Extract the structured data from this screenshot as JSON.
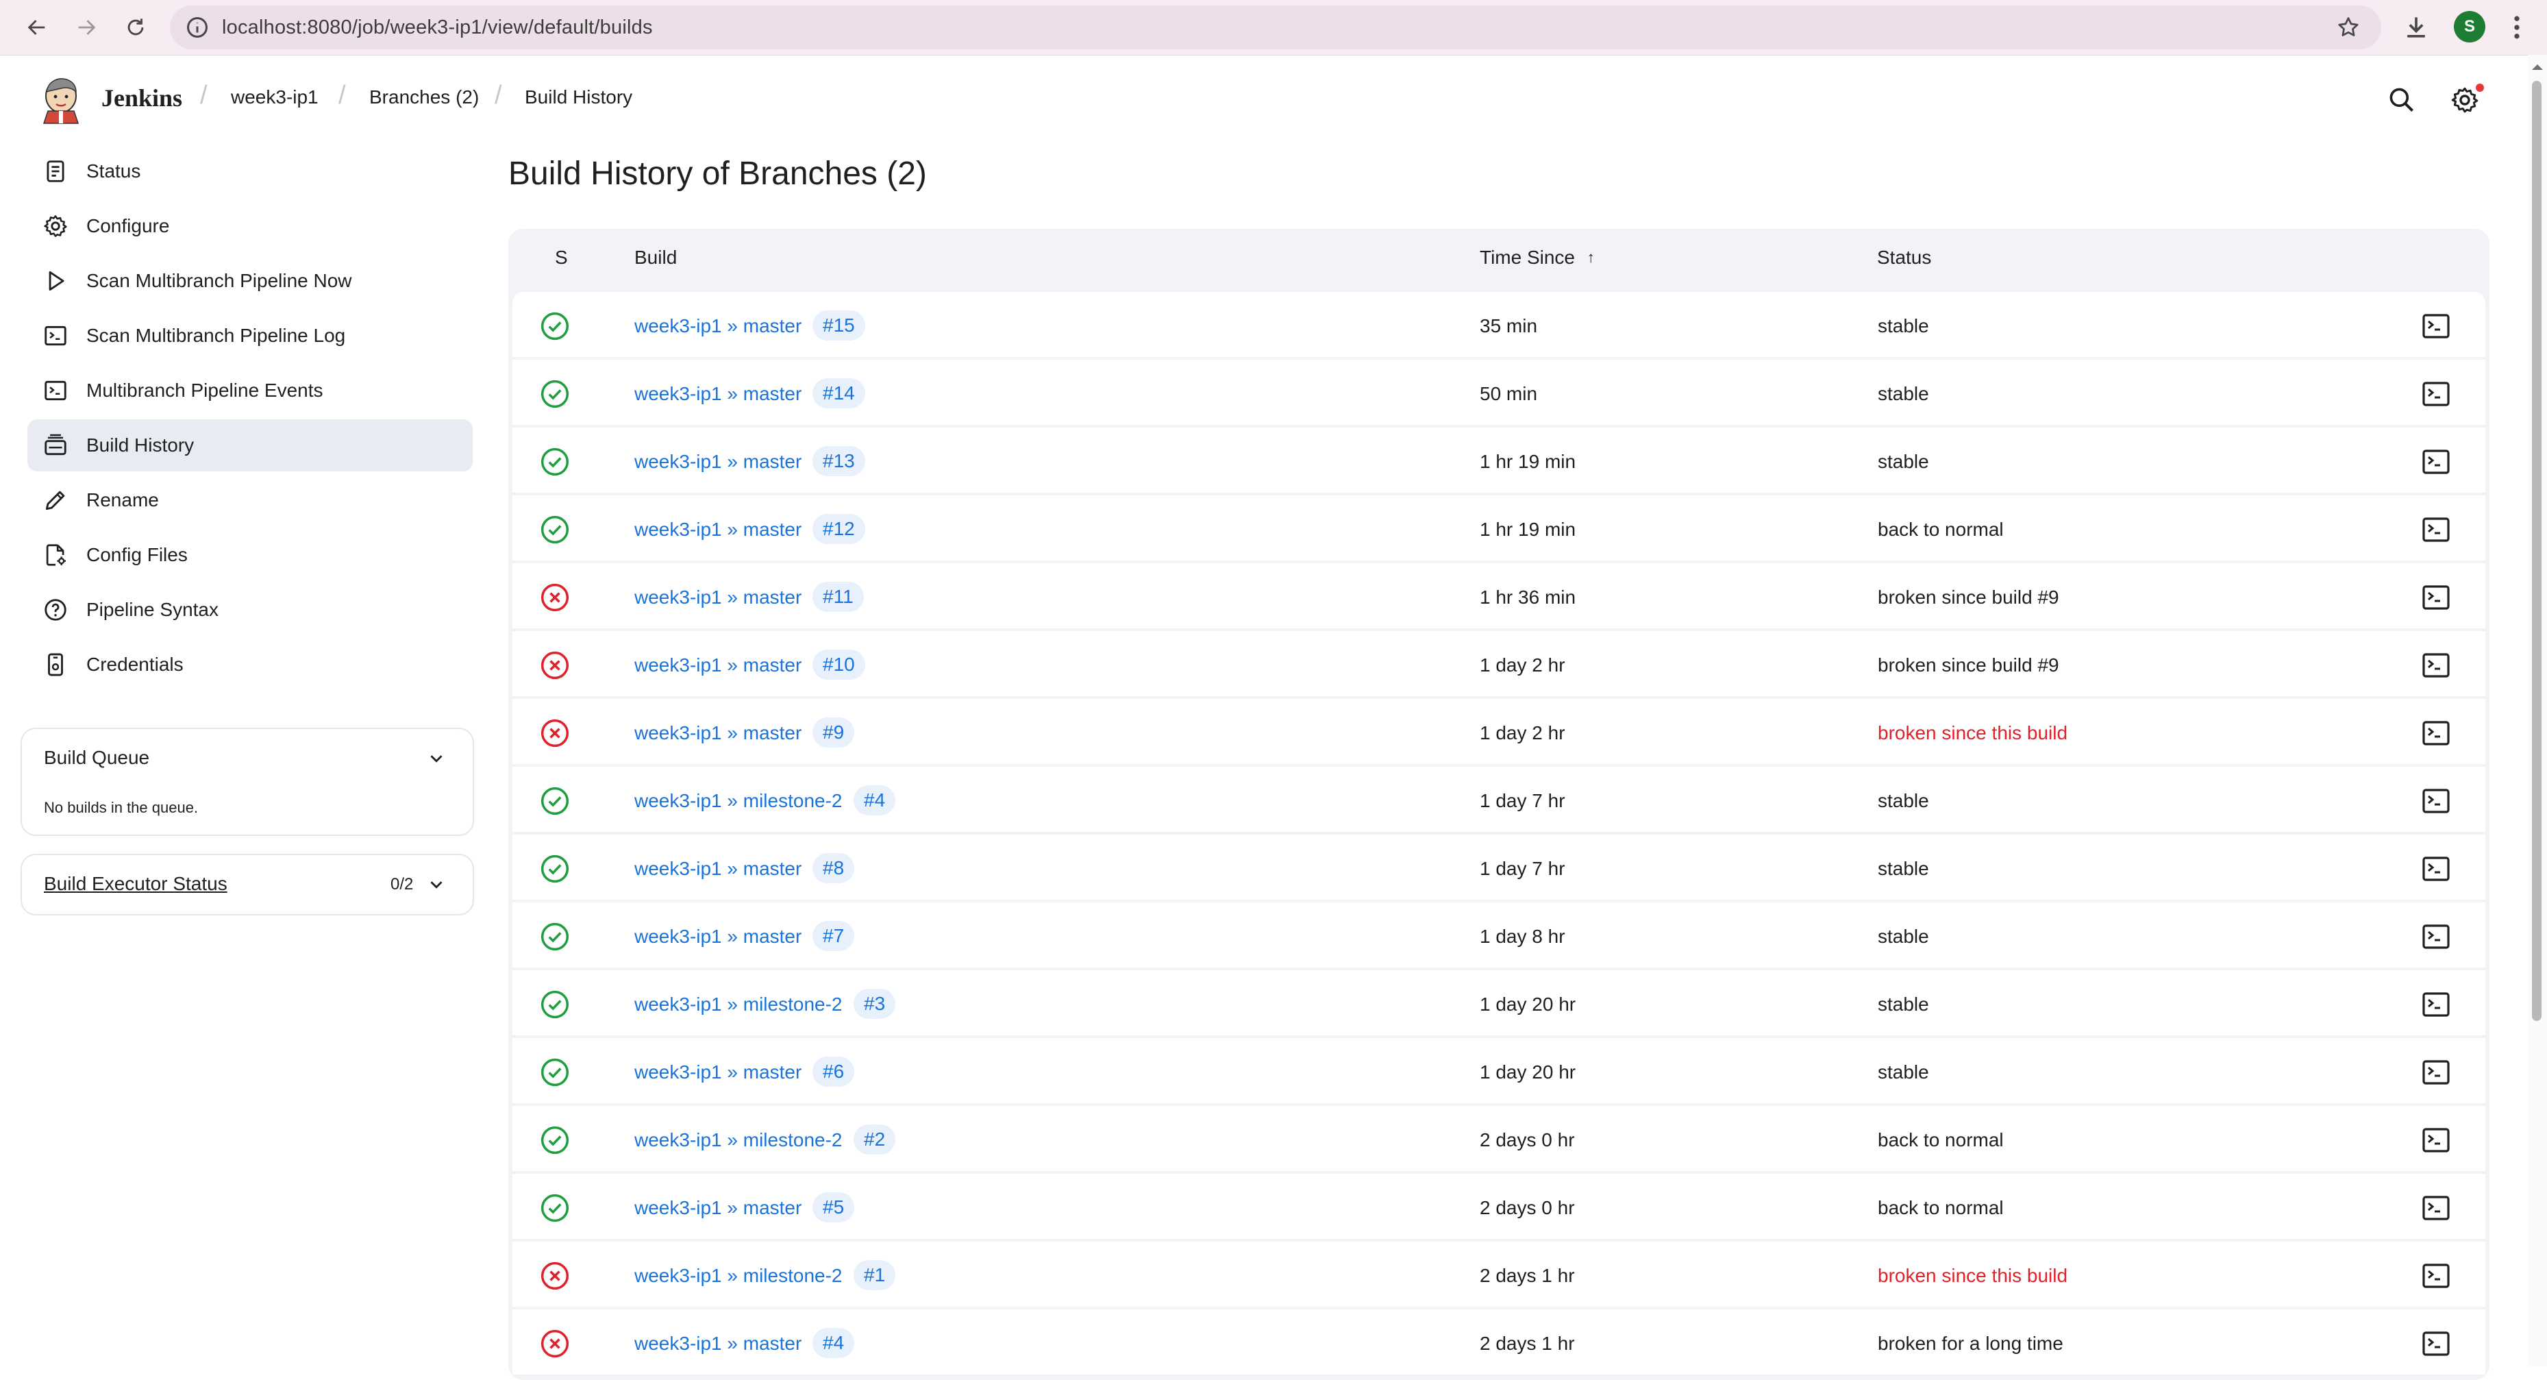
{
  "browser": {
    "url": "localhost:8080/job/week3-ip1/view/default/builds",
    "profile_initial": "S"
  },
  "header": {
    "brand": "Jenkins",
    "breadcrumbs": [
      "week3-ip1",
      "Branches (2)",
      "Build History"
    ]
  },
  "sidebar": {
    "items": [
      {
        "label": "Status",
        "icon": "status-document-icon"
      },
      {
        "label": "Configure",
        "icon": "gear-icon"
      },
      {
        "label": "Scan Multibranch Pipeline Now",
        "icon": "play-icon"
      },
      {
        "label": "Scan Multibranch Pipeline Log",
        "icon": "terminal-icon"
      },
      {
        "label": "Multibranch Pipeline Events",
        "icon": "terminal-icon"
      },
      {
        "label": "Build History",
        "icon": "build-history-icon",
        "active": true
      },
      {
        "label": "Rename",
        "icon": "pencil-icon"
      },
      {
        "label": "Config Files",
        "icon": "config-files-icon"
      },
      {
        "label": "Pipeline Syntax",
        "icon": "help-circle-icon"
      },
      {
        "label": "Credentials",
        "icon": "credentials-icon"
      }
    ],
    "build_queue": {
      "title": "Build Queue",
      "empty_text": "No builds in the queue."
    },
    "executor_status": {
      "title": "Build Executor Status",
      "count": "0/2"
    }
  },
  "main": {
    "title": "Build History of Branches (2)",
    "columns": {
      "s": "S",
      "build": "Build",
      "time_since": "Time Since",
      "sort_indicator": "↑",
      "status": "Status"
    },
    "rows": [
      {
        "result": "success",
        "job": "week3-ip1 » master",
        "number": "#15",
        "time": "35 min",
        "status": "stable"
      },
      {
        "result": "success",
        "job": "week3-ip1 » master",
        "number": "#14",
        "time": "50 min",
        "status": "stable"
      },
      {
        "result": "success",
        "job": "week3-ip1 » master",
        "number": "#13",
        "time": "1 hr 19 min",
        "status": "stable"
      },
      {
        "result": "success",
        "job": "week3-ip1 » master",
        "number": "#12",
        "time": "1 hr 19 min",
        "status": "back to normal"
      },
      {
        "result": "failure",
        "job": "week3-ip1 » master",
        "number": "#11",
        "time": "1 hr 36 min",
        "status": "broken since build #9"
      },
      {
        "result": "failure",
        "job": "week3-ip1 » master",
        "number": "#10",
        "time": "1 day 2 hr",
        "status": "broken since build #9"
      },
      {
        "result": "failure",
        "job": "week3-ip1 » master",
        "number": "#9",
        "time": "1 day 2 hr",
        "status": "broken since this build",
        "status_emphasis": "red"
      },
      {
        "result": "success",
        "job": "week3-ip1 » milestone-2",
        "number": "#4",
        "time": "1 day 7 hr",
        "status": "stable"
      },
      {
        "result": "success",
        "job": "week3-ip1 » master",
        "number": "#8",
        "time": "1 day 7 hr",
        "status": "stable"
      },
      {
        "result": "success",
        "job": "week3-ip1 » master",
        "number": "#7",
        "time": "1 day 8 hr",
        "status": "stable"
      },
      {
        "result": "success",
        "job": "week3-ip1 » milestone-2",
        "number": "#3",
        "time": "1 day 20 hr",
        "status": "stable"
      },
      {
        "result": "success",
        "job": "week3-ip1 » master",
        "number": "#6",
        "time": "1 day 20 hr",
        "status": "stable"
      },
      {
        "result": "success",
        "job": "week3-ip1 » milestone-2",
        "number": "#2",
        "time": "2 days 0 hr",
        "status": "back to normal"
      },
      {
        "result": "success",
        "job": "week3-ip1 » master",
        "number": "#5",
        "time": "2 days 0 hr",
        "status": "back to normal"
      },
      {
        "result": "failure",
        "job": "week3-ip1 » milestone-2",
        "number": "#1",
        "time": "2 days 1 hr",
        "status": "broken since this build",
        "status_emphasis": "red"
      },
      {
        "result": "failure",
        "job": "week3-ip1 » master",
        "number": "#4",
        "time": "2 days 1 hr",
        "status": "broken for a long time"
      }
    ]
  },
  "colors": {
    "success": "#1e9e3e",
    "failure": "#e0212a",
    "link": "#1a73d9",
    "badge_bg": "#e7f0fb",
    "active_nav_bg": "#e8ecf2"
  }
}
